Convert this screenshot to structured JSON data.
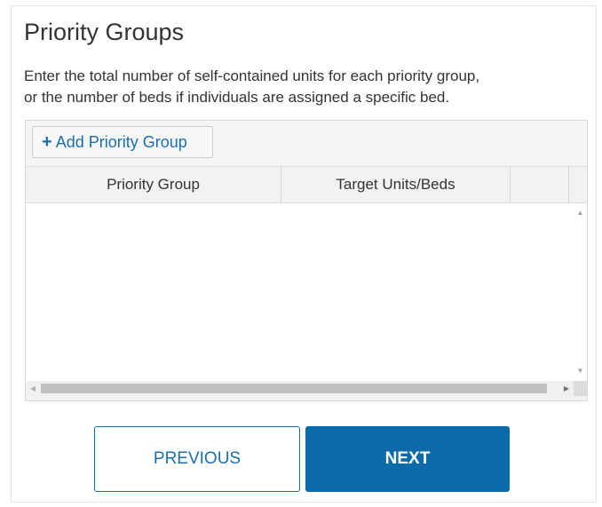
{
  "section": {
    "title": "Priority Groups",
    "description_line1": "Enter the total number of self-contained units for each priority group,",
    "description_line2": "or the number of beds if individuals are assigned a specific bed."
  },
  "grid": {
    "toolbar": {
      "add_icon": "+",
      "add_label": "Add Priority Group"
    },
    "columns": [
      "Priority Group",
      "Target Units/Beds",
      ""
    ],
    "rows": []
  },
  "navigation": {
    "previous_label": "PREVIOUS",
    "next_label": "NEXT"
  },
  "colors": {
    "accent": "#0b6aa8",
    "link": "#1a6fb0"
  }
}
